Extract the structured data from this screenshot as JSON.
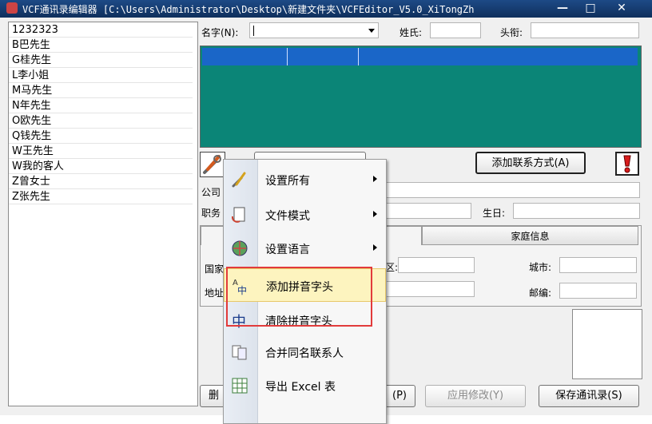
{
  "window": {
    "title": "VCF通讯录编辑器 [C:\\Users\\Administrator\\Desktop\\新建文件夹\\VCFEditor_V5.0_XiTongZh",
    "minimize": "—",
    "maximize": "□",
    "close": "✕"
  },
  "contacts": [
    "1232323",
    "B巴先生",
    "G桂先生",
    "L李小姐",
    "M马先生",
    "N年先生",
    "O欧先生",
    "Q钱先生",
    "W王先生",
    "W我的客人",
    "Z曾女士",
    "Z张先生"
  ],
  "form": {
    "name_label": "名字(N):",
    "surname_label": "姓氏:",
    "title_label": "头衔:",
    "company_label": "公司",
    "position_label": "职务",
    "birthday_label": "生日:",
    "country_label": "国家",
    "address_label": "地址",
    "district_label": "区:",
    "city_label": "城市:",
    "postcode_label": "邮编:"
  },
  "buttons": {
    "add_contact_method": "添加联系方式(A)",
    "delete_partial": "删",
    "p_partial": "(P)",
    "apply_changes": "应用修改(Y)",
    "save_contacts": "保存通讯录(S)"
  },
  "tabs": {
    "family_info": "家庭信息"
  },
  "menu": {
    "items": [
      {
        "label": "设置所有",
        "submenu": true
      },
      {
        "label": "文件模式",
        "submenu": true
      },
      {
        "label": "设置语言",
        "submenu": true
      },
      {
        "label": "添加拼音字头",
        "submenu": false
      },
      {
        "label": "清除拼音字头",
        "submenu": false
      },
      {
        "label": "合并同名联系人",
        "submenu": false
      },
      {
        "label": "导出 Excel 表",
        "submenu": false
      }
    ]
  },
  "colors": {
    "grid": "#0b8577",
    "grid_header": "#1a66c8",
    "highlight_box": "#e23b3b"
  }
}
